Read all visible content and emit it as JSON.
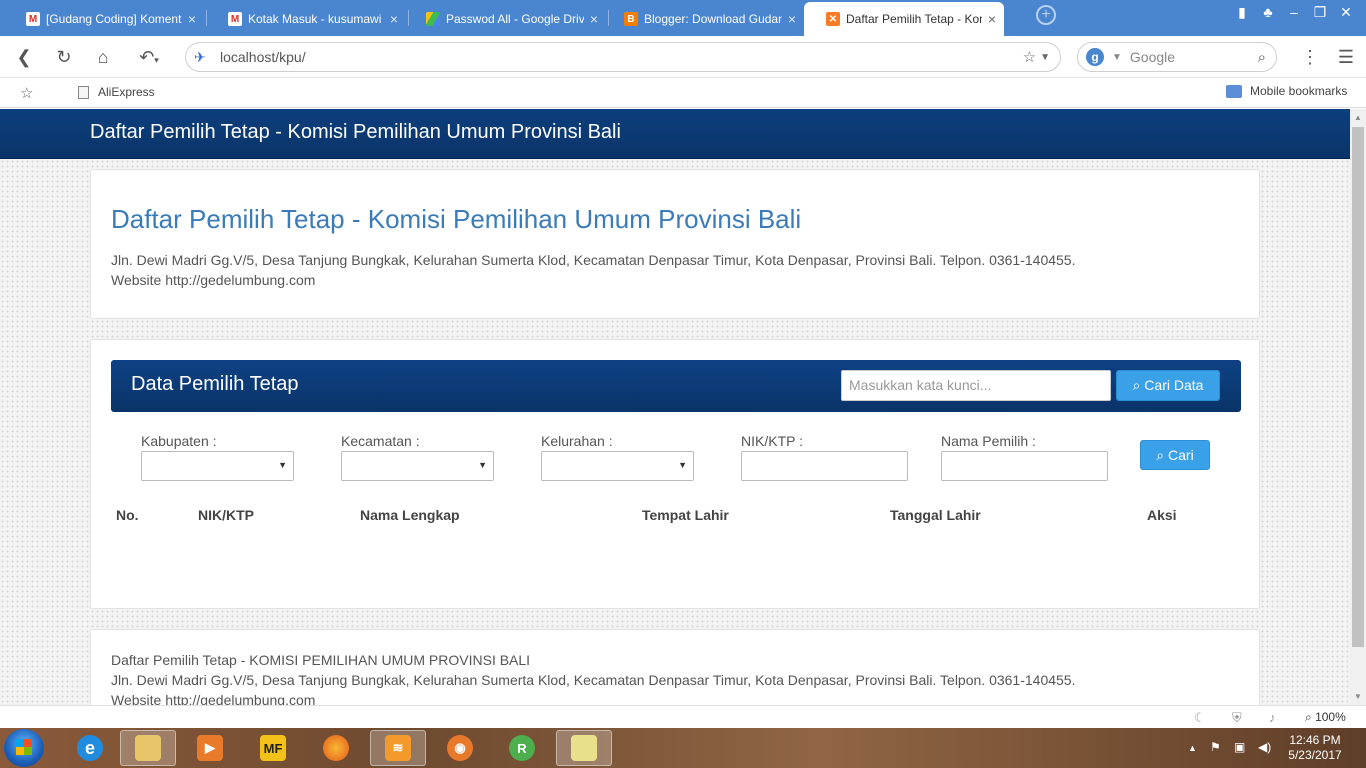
{
  "browser": {
    "tabs": [
      {
        "label": "[Gudang Coding] Koment",
        "icon": "gmail-icon"
      },
      {
        "label": "Kotak Masuk - kusumawi",
        "icon": "gmail-icon"
      },
      {
        "label": "Passwod All - Google Driv",
        "icon": "google-drive-icon"
      },
      {
        "label": "Blogger: Download Gudan",
        "icon": "blogger-icon"
      },
      {
        "label": "Daftar Pemilih Tetap - Kon",
        "icon": "xampp-icon",
        "active": true
      }
    ],
    "url": "localhost/kpu/",
    "search_placeholder": "Google",
    "bookmarks": [
      {
        "label": "AliExpress"
      }
    ],
    "mobile_bookmarks": "Mobile bookmarks"
  },
  "page": {
    "navbar_title": "Daftar Pemilih Tetap - Komisi Pemilihan Umum Provinsi Bali",
    "jumbotron": {
      "title": "Daftar Pemilih Tetap - Komisi Pemilihan Umum Provinsi Bali",
      "address": "Jln. Dewi Madri Gg.V/5, Desa Tanjung Bungkak, Kelurahan Sumerta Klod, Kecamatan Denpasar Timur, Kota Denpasar, Provinsi Bali. Telpon. 0361-140455.",
      "website": "Website http://gedelumbung.com"
    },
    "panel": {
      "title": "Data Pemilih Tetap",
      "search_placeholder": "Masukkan kata kunci...",
      "search_button": "Cari Data",
      "filters": {
        "kabupaten": "Kabupaten :",
        "kecamatan": "Kecamatan :",
        "kelurahan": "Kelurahan :",
        "nik": "NIK/KTP :",
        "nama": "Nama Pemilih :"
      },
      "cari_button": "Cari",
      "table_headers": [
        "No.",
        "NIK/KTP",
        "Nama Lengkap",
        "Tempat Lahir",
        "Tanggal Lahir",
        "Aksi"
      ]
    },
    "footer": {
      "line1": "Daftar Pemilih Tetap - KOMISI PEMILIHAN UMUM PROVINSI BALI",
      "line2": "Jln. Dewi Madri Gg.V/5, Desa Tanjung Bungkak, Kelurahan Sumerta Klod, Kecamatan Denpasar Timur, Kota Denpasar, Provinsi Bali. Telpon. 0361-140455.",
      "line3": "Website http://gedelumbung.com"
    }
  },
  "statusbar": {
    "zoom": "100%"
  },
  "taskbar": {
    "apps": [
      "internet-explorer",
      "file-explorer",
      "media-player",
      "mf-app",
      "firefox",
      "uc-browser",
      "vpn-app",
      "r-app",
      "notes-app"
    ],
    "mf_label": "MF",
    "r_label": "R",
    "time": "12:46 PM",
    "date": "5/23/2017"
  },
  "colors": {
    "navbar": "#0a3468",
    "title_blue": "#3a7bb8",
    "button_blue": "#3aa0e8",
    "tabbar": "#4a86cf"
  }
}
